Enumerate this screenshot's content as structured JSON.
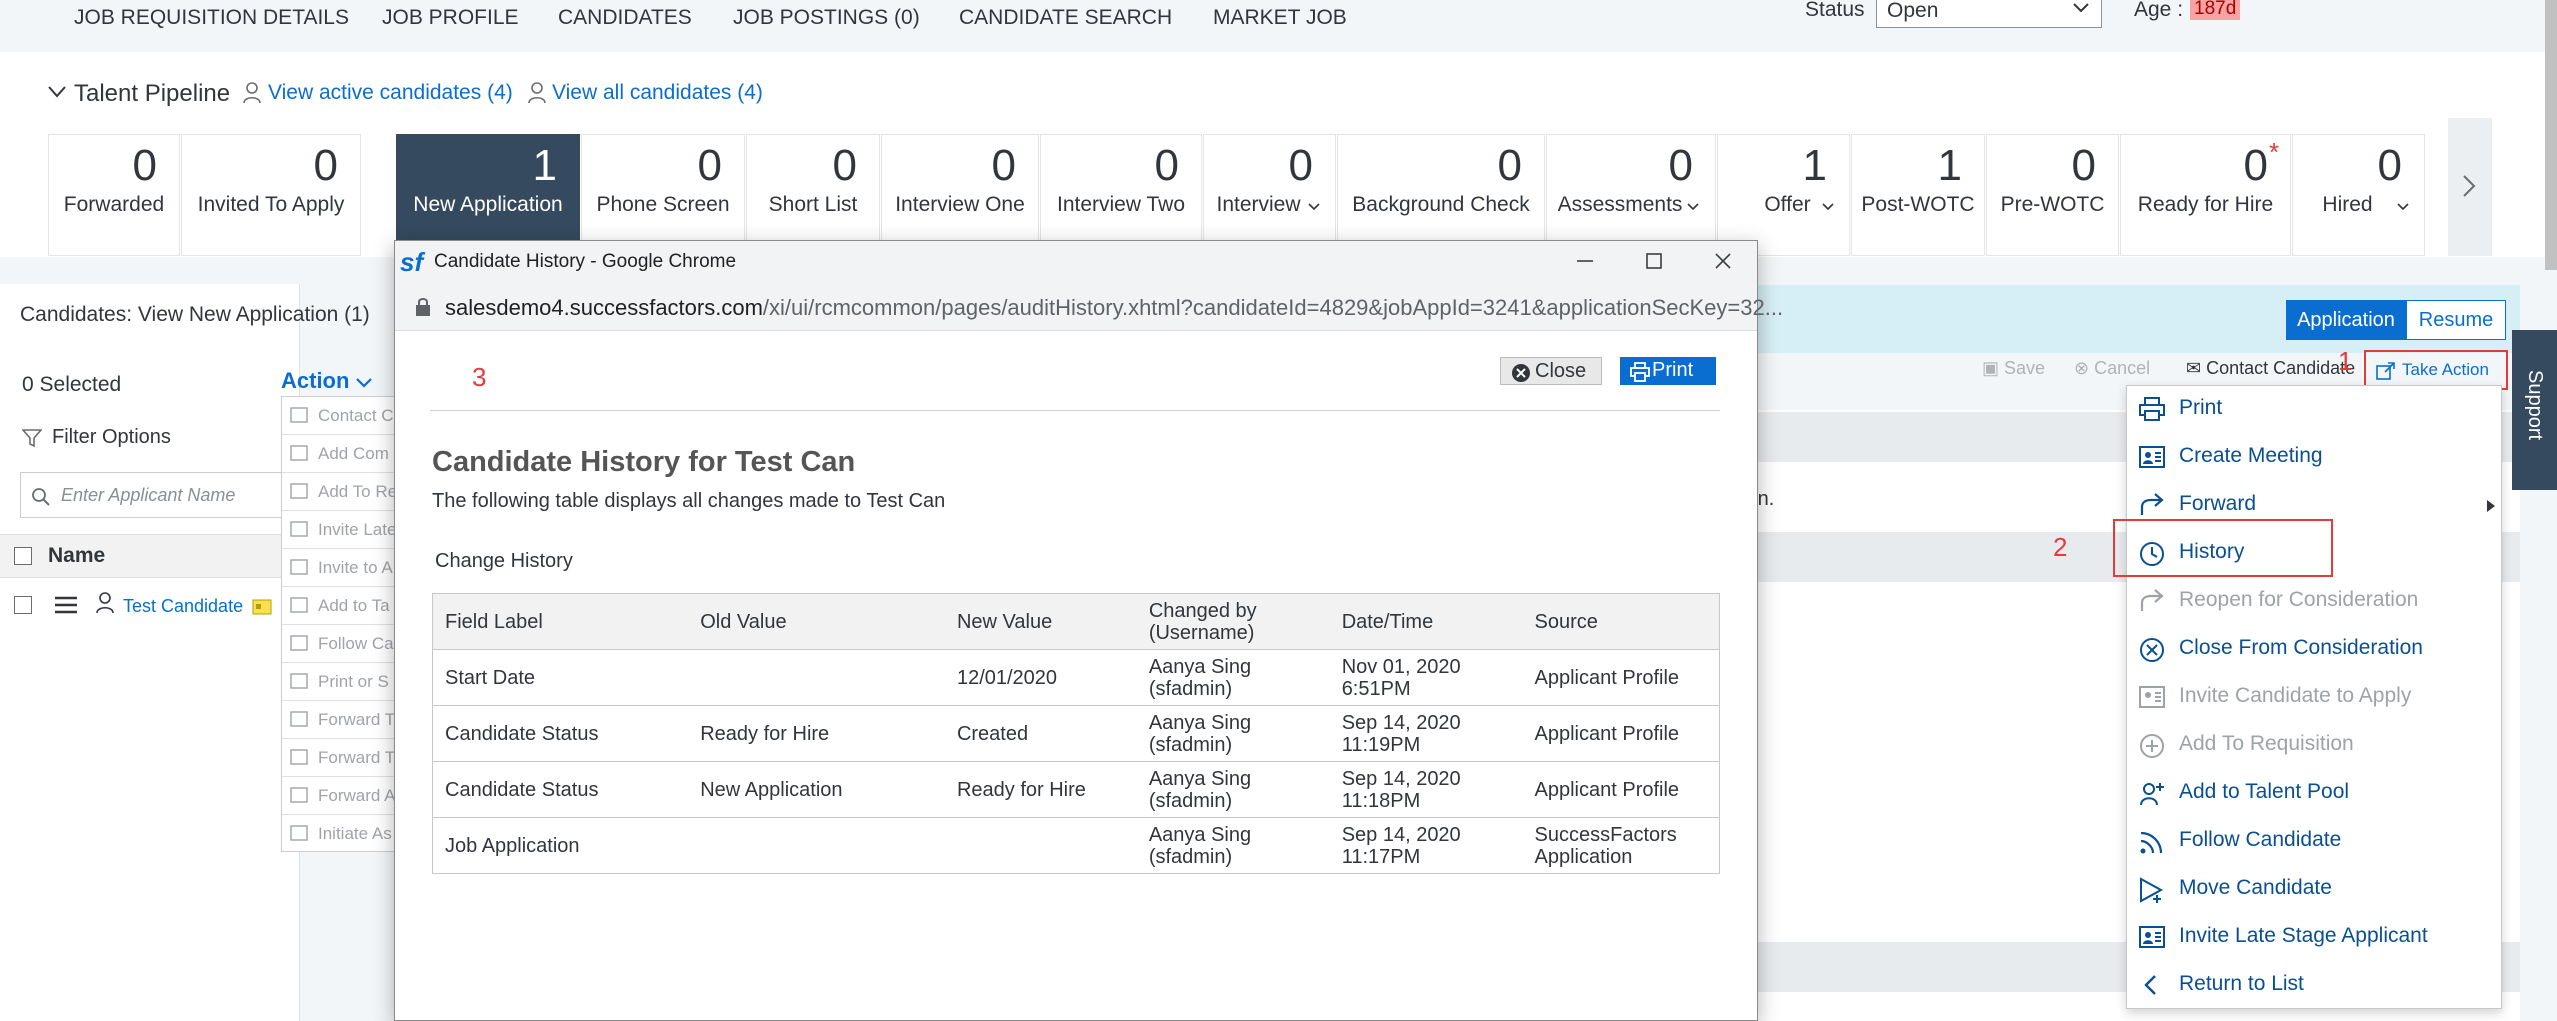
{
  "topnav": {
    "tabs": [
      "JOB REQUISITION DETAILS",
      "JOB PROFILE",
      "CANDIDATES",
      "JOB POSTINGS (0)",
      "CANDIDATE SEARCH",
      "MARKET JOB"
    ],
    "status_label": "Status",
    "status_value": "Open",
    "age_label": "Age :",
    "age_value": "187d"
  },
  "pipeline": {
    "title": "Talent Pipeline",
    "view_active": "View active candidates (4)",
    "view_all": "View all candidates (4)",
    "stages": [
      {
        "count": "0",
        "label": "Forwarded"
      },
      {
        "count": "0",
        "label": "Invited To Apply"
      },
      {
        "count": "1",
        "label": "New Application"
      },
      {
        "count": "0",
        "label": "Phone Screen"
      },
      {
        "count": "0",
        "label": "Short List"
      },
      {
        "count": "0",
        "label": "Interview One"
      },
      {
        "count": "0",
        "label": "Interview Two"
      },
      {
        "count": "0",
        "label": "Interview"
      },
      {
        "count": "0",
        "label": "Background Check"
      },
      {
        "count": "0",
        "label": "Assessments"
      },
      {
        "count": "1",
        "label": "Offer"
      },
      {
        "count": "1",
        "label": "Post-WOTC"
      },
      {
        "count": "0",
        "label": "Pre-WOTC"
      },
      {
        "count": "0",
        "label": "Ready for Hire"
      },
      {
        "count": "0",
        "label": "Hired"
      }
    ]
  },
  "left": {
    "title": "Candidates: View New Application (1)",
    "selected": "0 Selected",
    "filter": "Filter Options",
    "search_placeholder": "Enter Applicant Name",
    "name_header": "Name",
    "candidate": "Test Candidate",
    "action_label": "Action",
    "action_items": [
      "Contact C",
      "Add Com",
      "Add To Re",
      "Invite Late",
      "Invite to A",
      "Add to Ta",
      "Follow Ca",
      "Print or S",
      "Forward T",
      "Forward T",
      "Forward A",
      "Initiate As"
    ]
  },
  "right": {
    "tab_application": "Application",
    "tab_resume": "Resume",
    "save": "Save",
    "cancel": "Cancel",
    "contact": "Contact Candidate",
    "take_action": "Take Action",
    "partial_text": "ion.",
    "support": "Support"
  },
  "menu": {
    "items": [
      {
        "label": "Print",
        "icon": "print-icon",
        "disabled": false
      },
      {
        "label": "Create Meeting",
        "icon": "meeting-icon",
        "disabled": false
      },
      {
        "label": "Forward",
        "icon": "forward-icon",
        "disabled": false
      },
      {
        "label": "History",
        "icon": "history-icon",
        "disabled": false
      },
      {
        "label": "Reopen for Consideration",
        "icon": "reopen-icon",
        "disabled": true
      },
      {
        "label": "Close From Consideration",
        "icon": "close-circle-icon",
        "disabled": false
      },
      {
        "label": "Invite Candidate to Apply",
        "icon": "invite-icon",
        "disabled": true
      },
      {
        "label": "Add To Requisition",
        "icon": "add-circle-icon",
        "disabled": true
      },
      {
        "label": "Add to Talent Pool",
        "icon": "add-person-icon",
        "disabled": false
      },
      {
        "label": "Follow Candidate",
        "icon": "follow-icon",
        "disabled": false
      },
      {
        "label": "Move Candidate",
        "icon": "move-icon",
        "disabled": false
      },
      {
        "label": "Invite Late Stage Applicant",
        "icon": "invite-late-icon",
        "disabled": false
      },
      {
        "label": "Return to List",
        "icon": "chevron-left-icon",
        "disabled": false
      }
    ]
  },
  "annotations": {
    "one": "1",
    "two": "2",
    "three": "3"
  },
  "popup": {
    "logo": "sf",
    "window_title": "Candidate History - Google Chrome",
    "url_host": "salesdemo4.successfactors.com",
    "url_path": "/xi/ui/rcmcommon/pages/auditHistory.xhtml?candidateId=4829&jobAppId=3241&applicationSecKey=32...",
    "close_label": "Close",
    "print_label": "Print",
    "heading": "Candidate History for Test Can",
    "subheading": "The following table displays all changes made to Test Can",
    "change_history": "Change History",
    "columns": [
      "Field Label",
      "Old Value",
      "New Value",
      "Changed by (Username)",
      "Date/Time",
      "Source"
    ],
    "rows": [
      [
        "Start Date",
        "",
        "12/01/2020",
        "Aanya Sing (sfadmin)",
        "Nov 01, 2020 6:51PM",
        "Applicant Profile"
      ],
      [
        "Candidate Status",
        "Ready for Hire",
        "Created",
        "Aanya Sing (sfadmin)",
        "Sep 14, 2020 11:19PM",
        "Applicant Profile"
      ],
      [
        "Candidate Status",
        "New Application",
        "Ready for Hire",
        "Aanya Sing (sfadmin)",
        "Sep 14, 2020 11:18PM",
        "Applicant Profile"
      ],
      [
        "Job Application",
        "",
        "",
        "Aanya Sing (sfadmin)",
        "Sep 14, 2020 11:17PM",
        "SuccessFactors Application"
      ]
    ]
  },
  "colors": {
    "accent": "#0a6ed1",
    "active_stage": "#354a5f",
    "annotation": "#e23b3b"
  }
}
